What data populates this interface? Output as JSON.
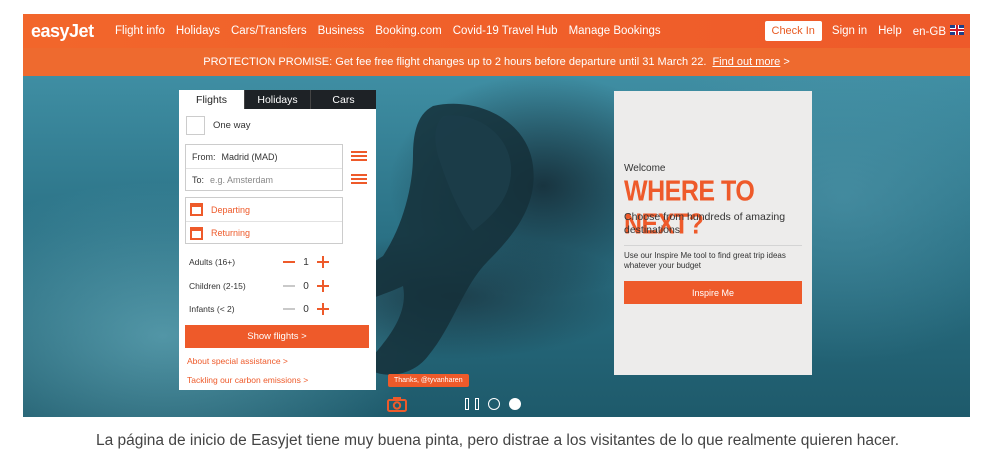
{
  "header": {
    "logo": "easyJet",
    "nav": [
      "Flight info",
      "Holidays",
      "Cars/Transfers",
      "Business",
      "Booking.com",
      "Covid-19 Travel Hub",
      "Manage Bookings"
    ],
    "check_in": "Check In",
    "sign_in": "Sign in",
    "help": "Help",
    "locale": "en-GB",
    "brand_color": "#ee5a2a"
  },
  "promo": {
    "text": "PROTECTION PROMISE:  Get fee free flight changes up to 2 hours before departure until 31 March 22.",
    "link": "Find out more",
    "arrow": ">"
  },
  "booking": {
    "tabs": [
      "Flights",
      "Holidays",
      "Cars"
    ],
    "active_tab": "Flights",
    "one_way": "One way",
    "from_label": "From:",
    "from_value": "Madrid (MAD)",
    "to_label": "To:",
    "to_placeholder": "e.g. Amsterdam",
    "departing": "Departing",
    "returning": "Returning",
    "passengers": [
      {
        "label": "Adults (16+)",
        "count": "1"
      },
      {
        "label": "Children (2-15)",
        "count": "0"
      },
      {
        "label": "Infants (< 2)",
        "count": "0"
      }
    ],
    "show_flights": "Show flights >",
    "special_assistance": "About special assistance >",
    "carbon": "Tackling our carbon emissions >"
  },
  "inspire": {
    "welcome": "Welcome",
    "headline": "WHERE TO NEXT?",
    "subtitle": "Choose from hundreds of amazing destinations",
    "tool_text": "Use our Inspire Me tool to find great trip ideas whatever your budget",
    "button": "Inspire Me"
  },
  "photo_credit": "Thanks, @tyvanharen",
  "carousel": {
    "slides": 2,
    "active": 2
  },
  "caption": "La página de inicio de Easyjet tiene muy buena pinta, pero distrae a los visitantes de lo que realmente quieren hacer."
}
